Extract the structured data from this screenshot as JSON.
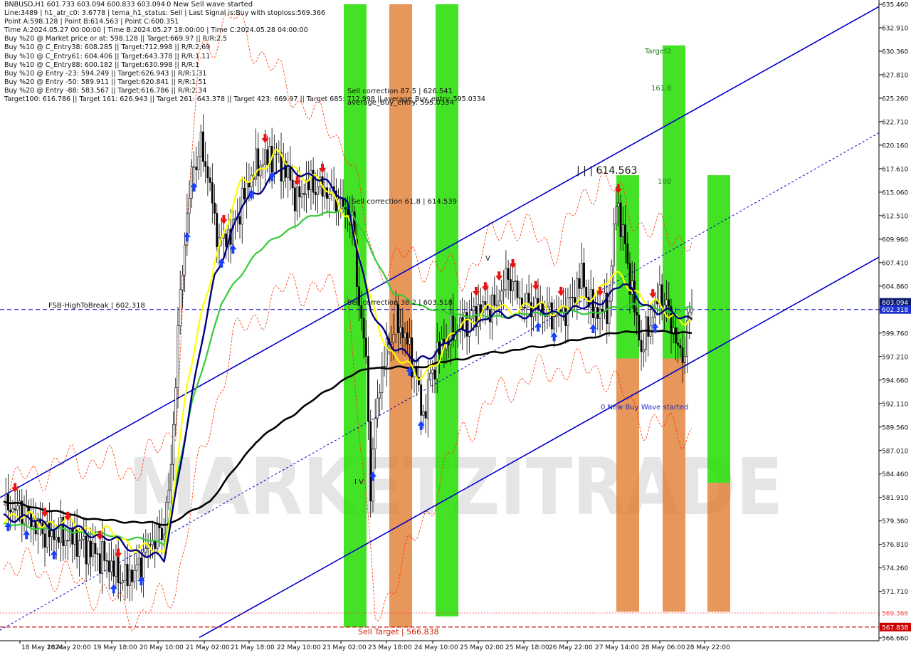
{
  "header": {
    "symbol_line": "BNBUSD,H1  601.733 603.094 600.833 603.094",
    "lines": [
      "Line:3489 | h1_atr_c0: 3.6778 | tema_h1_status: Sell | Last Signal is:Buy with stoploss:569.366",
      "Point A:598.128 | Point B:614.563 | Point C:600.351",
      "Time A:2024.05.27 00:00:00 | Time B:2024.05.27 18:00:00 | Time C:2024.05.28 04:00:00",
      "Buy %20 @ Market price or at: 598.128 || Target:669.97 || R/R:2.5",
      "Buy %10 @ C_Entry38: 608.285 || Target:712.998 || R/R:2.69",
      "Buy %10 @ C_Entry61: 604.406 || Target:643.378 || R/R:1.11",
      "Buy %10 @ C_Entry88: 600.182 || Target:630.998 || R/R:1",
      "Buy %10 @ Entry -23: 594.249 || Target:626.943 || R/R:1.31",
      "Buy %20 @ Entry -50: 589.911 || Target:620.841 || R/R:1.51",
      "Buy %20 @ Entry -88: 583.567 || Target:616.786 || R/R:2.34",
      "Target100: 616.786 || Target 161: 626.943 || Target 261: 643.378 || Target 423: 669.97 || Target 685: 712.998 || average_Buy_entry: 595.0334"
    ]
  },
  "annotations": {
    "top_signal": "0 New Sell wave started",
    "sell_correction_875": "Sell correction 87.5 | 626.541",
    "average_buy_entry": "average_Buy_entry: 595.0334",
    "sell_correction_618": "Sell correction 61.8 | 614.539",
    "sell_correction_382": "Sell correction 38.2 | 603.518",
    "fsb_label": "FSB-HighToBreak | 602.318",
    "point_b": "| | | 614.563",
    "target2": "Target2",
    "fib_1618": "161.8",
    "fib_100": "100",
    "wave_iv": "I V",
    "wave_v": "V",
    "buy_wave": "0 New Buy Wave started",
    "sell_target": "Sell Target | 566.838",
    "watermark": "MARKETZITRADE"
  },
  "colors": {
    "background": "#ffffff",
    "bull_green": "#22dd00",
    "bear_orange": "#e07a2a",
    "channel_blue": "#0000cc",
    "ema_black": "#000000",
    "ema_green": "#33cc33",
    "ema_navy": "#000080",
    "tema_yellow": "#ffff00",
    "envelope_red": "#ff3300",
    "current_price_bg": "#0a1a6b",
    "stop_red": "#ff4040",
    "sell_target_red": "#cc0000"
  },
  "chart_data": {
    "type": "candlestick",
    "title": "BNBUSD,H1",
    "ylim": [
      566.66,
      635.46
    ],
    "y_ticks": [
      "635.460",
      "632.910",
      "630.360",
      "627.810",
      "625.260",
      "622.710",
      "620.160",
      "617.610",
      "615.060",
      "612.510",
      "609.960",
      "607.410",
      "604.860",
      "602.310",
      "599.760",
      "597.210",
      "594.660",
      "592.110",
      "589.560",
      "587.010",
      "584.460",
      "581.910",
      "579.360",
      "576.810",
      "574.260",
      "571.710",
      "569.160",
      "566.660"
    ],
    "x_ticks": [
      "18 May 2024",
      "18 May 20:00",
      "19 May 18:00",
      "20 May 10:00",
      "21 May 02:00",
      "21 May 18:00",
      "22 May 10:00",
      "23 May 02:00",
      "23 May 18:00",
      "24 May 10:00",
      "25 May 02:00",
      "25 May 18:00",
      "26 May 22:00",
      "27 May 14:00",
      "28 May 06:00",
      "28 May 22:00"
    ],
    "current_price": "603.094",
    "fsb_price": "602.318",
    "stoploss_price": "569.366",
    "sell_target_price": "567.838",
    "price_anchors": [
      [
        0,
        581.0
      ],
      [
        8,
        580.5
      ],
      [
        18,
        578.0
      ],
      [
        30,
        577.5
      ],
      [
        45,
        575.0
      ],
      [
        52,
        573.0
      ],
      [
        58,
        574.0
      ],
      [
        64,
        577.0
      ],
      [
        70,
        578.5
      ],
      [
        73,
        585.0
      ],
      [
        76,
        600.0
      ],
      [
        79,
        610.0
      ],
      [
        82,
        617.0
      ],
      [
        86,
        620.0
      ],
      [
        90,
        616.0
      ],
      [
        92,
        611.5
      ],
      [
        95,
        609.5
      ],
      [
        100,
        611.0
      ],
      [
        104,
        614.0
      ],
      [
        108,
        617.0
      ],
      [
        113,
        618.5
      ],
      [
        118,
        619.0
      ],
      [
        124,
        617.0
      ],
      [
        128,
        614.0
      ],
      [
        132,
        616.0
      ],
      [
        138,
        615.5
      ],
      [
        145,
        614.5
      ],
      [
        152,
        612.0
      ],
      [
        155,
        603.0
      ],
      [
        158,
        597.0
      ],
      [
        160,
        583.0
      ],
      [
        163,
        593.0
      ],
      [
        167,
        598.0
      ],
      [
        171,
        601.0
      ],
      [
        175,
        599.5
      ],
      [
        179,
        596.0
      ],
      [
        183,
        590.5
      ],
      [
        186,
        595.0
      ],
      [
        190,
        598.0
      ],
      [
        196,
        600.0
      ],
      [
        202,
        601.0
      ],
      [
        208,
        602.5
      ],
      [
        214,
        602.5
      ],
      [
        220,
        606.0
      ],
      [
        226,
        603.0
      ],
      [
        234,
        602.5
      ],
      [
        240,
        601.5
      ],
      [
        246,
        602.5
      ],
      [
        252,
        606.0
      ],
      [
        256,
        602.5
      ],
      [
        260,
        602.0
      ],
      [
        264,
        603.0
      ],
      [
        267,
        614.5
      ],
      [
        271,
        609.0
      ],
      [
        274,
        604.0
      ],
      [
        278,
        598.0
      ],
      [
        282,
        601.0
      ],
      [
        286,
        604.0
      ],
      [
        290,
        602.0
      ],
      [
        294,
        598.0
      ],
      [
        296,
        597.0
      ],
      [
        300,
        603.0
      ]
    ],
    "ema_black_anchors": [
      [
        0,
        581.5
      ],
      [
        40,
        579.5
      ],
      [
        72,
        579.0
      ],
      [
        90,
        581.5
      ],
      [
        110,
        588.0
      ],
      [
        135,
        592.5
      ],
      [
        150,
        595.0
      ],
      [
        160,
        596.0
      ],
      [
        180,
        596.0
      ],
      [
        210,
        597.5
      ],
      [
        240,
        598.5
      ],
      [
        260,
        599.5
      ],
      [
        275,
        600.0
      ],
      [
        300,
        599.8
      ]
    ],
    "ema_green_anchors": [
      [
        0,
        579.0
      ],
      [
        40,
        578.0
      ],
      [
        70,
        577.0
      ],
      [
        82,
        592.0
      ],
      [
        95,
        603.0
      ],
      [
        110,
        608.5
      ],
      [
        130,
        612.0
      ],
      [
        150,
        613.5
      ],
      [
        158,
        610.0
      ],
      [
        170,
        604.0
      ],
      [
        190,
        602.0
      ],
      [
        210,
        601.5
      ],
      [
        240,
        602.0
      ],
      [
        260,
        602.0
      ],
      [
        275,
        603.0
      ],
      [
        290,
        602.0
      ],
      [
        300,
        602.5
      ]
    ],
    "ema_navy_anchors": [
      [
        0,
        580.0
      ],
      [
        40,
        578.0
      ],
      [
        70,
        575.0
      ],
      [
        80,
        590.0
      ],
      [
        92,
        606.0
      ],
      [
        104,
        613.5
      ],
      [
        120,
        617.5
      ],
      [
        135,
        617.0
      ],
      [
        150,
        614.0
      ],
      [
        160,
        602.0
      ],
      [
        170,
        598.5
      ],
      [
        180,
        596.5
      ],
      [
        195,
        599.0
      ],
      [
        210,
        601.5
      ],
      [
        240,
        602.0
      ],
      [
        255,
        602.5
      ],
      [
        270,
        605.0
      ],
      [
        285,
        602.0
      ],
      [
        300,
        601.5
      ]
    ],
    "tema_yellow_anchors": [
      [
        0,
        580.0
      ],
      [
        40,
        578.5
      ],
      [
        70,
        575.5
      ],
      [
        80,
        594.0
      ],
      [
        92,
        608.0
      ],
      [
        104,
        616.0
      ],
      [
        118,
        619.0
      ],
      [
        135,
        616.5
      ],
      [
        150,
        613.0
      ],
      [
        160,
        603.0
      ],
      [
        168,
        598.0
      ],
      [
        180,
        595.0
      ],
      [
        190,
        597.0
      ],
      [
        200,
        601.0
      ],
      [
        215,
        602.5
      ],
      [
        235,
        602.5
      ],
      [
        250,
        602.5
      ],
      [
        265,
        606.0
      ],
      [
        278,
        604.0
      ],
      [
        290,
        601.5
      ],
      [
        300,
        601.5
      ]
    ],
    "envelope_upper_anchors": [
      [
        0,
        583.0
      ],
      [
        30,
        586.0
      ],
      [
        60,
        585.0
      ],
      [
        75,
        590.0
      ],
      [
        85,
        630.0
      ],
      [
        100,
        634.0
      ],
      [
        125,
        626.0
      ],
      [
        150,
        620.0
      ],
      [
        162,
        607.0
      ],
      [
        175,
        608.0
      ],
      [
        200,
        606.0
      ],
      [
        220,
        612.0
      ],
      [
        240,
        609.0
      ],
      [
        260,
        617.0
      ],
      [
        280,
        611.0
      ],
      [
        300,
        610.0
      ]
    ],
    "envelope_lower_anchors": [
      [
        0,
        575.0
      ],
      [
        30,
        573.0
      ],
      [
        60,
        569.0
      ],
      [
        75,
        572.0
      ],
      [
        85,
        585.0
      ],
      [
        100,
        599.0
      ],
      [
        125,
        605.0
      ],
      [
        150,
        604.0
      ],
      [
        162,
        569.0
      ],
      [
        175,
        575.0
      ],
      [
        200,
        589.0
      ],
      [
        220,
        594.0
      ],
      [
        240,
        596.0
      ],
      [
        260,
        596.0
      ],
      [
        280,
        590.0
      ],
      [
        300,
        589.0
      ]
    ],
    "channel_lines": [
      {
        "style": "solid",
        "from": [
          0,
          581.9
        ],
        "to": [
          1235,
          635.2
        ]
      },
      {
        "style": "solid",
        "from": [
          280,
          566.7
        ],
        "to": [
          1235,
          608.0
        ]
      },
      {
        "style": "dashed",
        "from": [
          0,
          567.5
        ],
        "to": [
          1235,
          621.5
        ]
      }
    ],
    "vertical_bands": [
      {
        "start": "23 May 02:00",
        "color": "bull_green",
        "top": 635.46,
        "bottom": 567.8
      },
      {
        "start": "23 May 18:00",
        "color": "bear_orange",
        "top": 635.46,
        "bottom": 567.8
      },
      {
        "start": "24 May 10:00",
        "color": "bull_green",
        "top": 635.46,
        "bottom": 569.0
      },
      {
        "start": "27 May 14:00",
        "color": "bull_green",
        "top": 616.9,
        "bottom": 597.0
      },
      {
        "start": "27 May 14:00",
        "color": "bear_orange",
        "top": 597.0,
        "bottom": 569.5
      },
      {
        "start": "28 May 06:00",
        "color": "bull_green",
        "top": 631.0,
        "bottom": 597.0
      },
      {
        "start": "28 May 06:00",
        "color": "bear_orange",
        "top": 597.0,
        "bottom": 569.5
      },
      {
        "start": "28 May 22:00",
        "color": "bull_green",
        "top": 616.9,
        "bottom": 583.5
      },
      {
        "start": "28 May 22:00",
        "color": "bear_orange",
        "top": 583.5,
        "bottom": 569.5
      }
    ],
    "buy_arrow_bars": [
      2,
      10,
      22,
      48,
      60,
      80,
      83,
      95,
      100,
      108,
      117,
      161,
      177,
      182,
      233,
      240,
      257,
      284
    ],
    "sell_arrow_bars": [
      5,
      18,
      28,
      42,
      50,
      96,
      114,
      128,
      139,
      206,
      210,
      216,
      222,
      232,
      243,
      260,
      268,
      283
    ],
    "grid": false,
    "legend": "none"
  }
}
